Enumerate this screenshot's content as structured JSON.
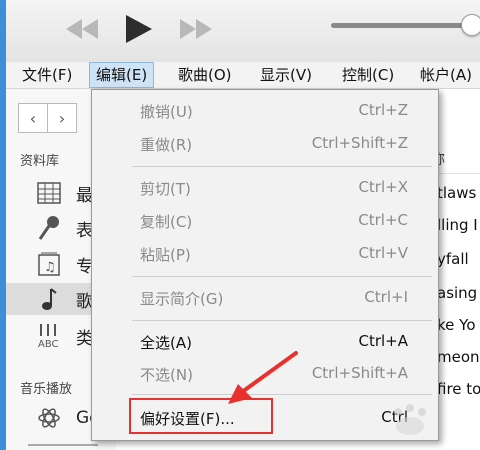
{
  "toolbar": {
    "prev_icon": "rewind-icon",
    "play_icon": "play-icon",
    "next_icon": "fast-forward-icon",
    "volume_level": 0.95
  },
  "menubar": {
    "items": [
      {
        "label": "文件(F)"
      },
      {
        "label": "编辑(E)",
        "active": true
      },
      {
        "label": "歌曲(O)"
      },
      {
        "label": "显示(V)"
      },
      {
        "label": "控制(C)"
      },
      {
        "label": "帐户(A)"
      }
    ]
  },
  "sidebar": {
    "nav_back": "‹",
    "nav_forward": "›",
    "library_title": "资料库",
    "library_items": [
      {
        "label": "最",
        "icon": "grid-icon"
      },
      {
        "label": "表",
        "icon": "microphone-icon"
      },
      {
        "label": "专",
        "icon": "album-icon"
      },
      {
        "label": "歌",
        "icon": "music-note-icon",
        "selected": true
      },
      {
        "label": "类",
        "icon": "genre-icon"
      }
    ],
    "playlists_title": "音乐播放",
    "playlist_items": [
      {
        "label": "Ge",
        "icon": "atom-icon"
      }
    ]
  },
  "songlist": {
    "header": "称",
    "songs": [
      "tlaws",
      "lling I",
      "yfall",
      "asing",
      "ke Yo",
      "meon",
      "fire to"
    ]
  },
  "dropdown": {
    "groups": [
      [
        {
          "label": "撤销(U)",
          "shortcut": "Ctrl+Z",
          "enabled": false
        },
        {
          "label": "重做(R)",
          "shortcut": "Ctrl+Shift+Z",
          "enabled": false
        }
      ],
      [
        {
          "label": "剪切(T)",
          "shortcut": "Ctrl+X",
          "enabled": false
        },
        {
          "label": "复制(C)",
          "shortcut": "Ctrl+C",
          "enabled": false
        },
        {
          "label": "粘贴(P)",
          "shortcut": "Ctrl+V",
          "enabled": false
        }
      ],
      [
        {
          "label": "显示简介(G)",
          "shortcut": "Ctrl+I",
          "enabled": false
        }
      ],
      [
        {
          "label": "全选(A)",
          "shortcut": "Ctrl+A",
          "enabled": true
        },
        {
          "label": "不选(N)",
          "shortcut": "Ctrl+Shift+A",
          "enabled": false
        }
      ],
      [
        {
          "label": "偏好设置(F)...",
          "shortcut": "Ctrl",
          "enabled": true
        }
      ]
    ]
  },
  "colors": {
    "highlight": "#e8302e",
    "menu_active": "#cfe3f7"
  }
}
